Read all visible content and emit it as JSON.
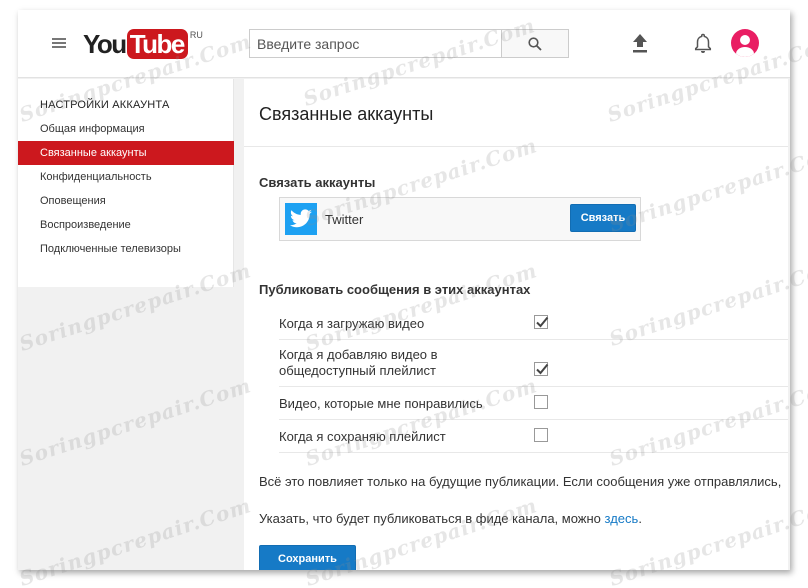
{
  "header": {
    "logo_you": "You",
    "logo_tube": "Tube",
    "logo_region": "RU",
    "search_placeholder": "Введите запрос"
  },
  "sidebar": {
    "heading": "НАСТРОЙКИ АККАУНТА",
    "items": [
      {
        "label": "Общая информация",
        "active": false
      },
      {
        "label": "Связанные аккаунты",
        "active": true
      },
      {
        "label": "Конфиденциальность",
        "active": false
      },
      {
        "label": "Оповещения",
        "active": false
      },
      {
        "label": "Воспроизведение",
        "active": false
      },
      {
        "label": "Подключенные телевизоры",
        "active": false
      }
    ]
  },
  "main": {
    "title": "Связанные аккаунты",
    "connect_section_title": "Связать аккаунты",
    "account": {
      "name": "Twitter",
      "button_label": "Связать"
    },
    "publish_section_title": "Публиковать сообщения в этих аккаунтах",
    "publish_options": [
      {
        "label": "Когда я загружаю видео",
        "checked": true
      },
      {
        "label": "Когда я добавляю видео в общедоступный плейлист",
        "checked": true
      },
      {
        "label": "Видео, которые мне понравились",
        "checked": false
      },
      {
        "label": "Когда я сохраняю плейлист",
        "checked": false
      }
    ],
    "note_future": "Всё это повлияет только на будущие публикации. Если сообщения уже отправлялись,",
    "note_feed_prefix": "Указать, что будет публиковаться в фиде канала, можно",
    "note_feed_link": "здесь",
    "note_feed_suffix": ".",
    "save_label": "Сохранить"
  },
  "watermark": "Soringpcrepair.Com",
  "colors": {
    "brand_red": "#cc181e",
    "accent_blue": "#167ac6",
    "twitter_blue": "#1da1f2",
    "avatar_pink": "#e91e63"
  }
}
